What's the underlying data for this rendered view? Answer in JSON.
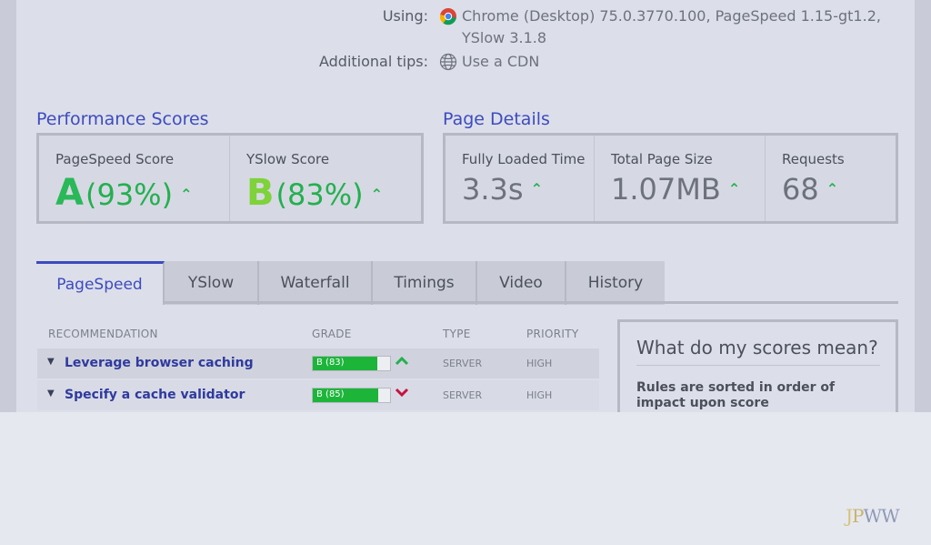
{
  "info": {
    "using_label": "Using:",
    "using_value_line1": "Chrome (Desktop) 75.0.3770.100, PageSpeed 1.15-gt1.2,",
    "using_value_line2": "YSlow 3.1.8",
    "tips_label": "Additional tips:",
    "tips_value": "Use a CDN",
    "icons": [
      "chrome-icon",
      "globe-icon"
    ]
  },
  "performance": {
    "title": "Performance Scores",
    "pagespeed": {
      "label": "PageSpeed Score",
      "grade": "A",
      "score": "(93%)"
    },
    "yslow": {
      "label": "YSlow Score",
      "grade": "B",
      "score": "(83%)"
    }
  },
  "details": {
    "title": "Page Details",
    "loaded": {
      "label": "Fully Loaded Time",
      "value": "3.3s"
    },
    "size": {
      "label": "Total Page Size",
      "value": "1.07MB"
    },
    "requests": {
      "label": "Requests",
      "value": "68"
    }
  },
  "tabs": [
    "PageSpeed",
    "YSlow",
    "Waterfall",
    "Timings",
    "Video",
    "History"
  ],
  "table": {
    "headers": {
      "recommendation": "RECOMMENDATION",
      "grade": "GRADE",
      "type": "TYPE",
      "priority": "PRIORITY"
    },
    "rows": [
      {
        "recommendation": "Leverage browser caching",
        "grade_text": "B (83)",
        "grade_value": 83,
        "trend": "up",
        "type": "SERVER",
        "priority": "HIGH"
      },
      {
        "recommendation": "Specify a cache validator",
        "grade_text": "B (85)",
        "grade_value": 85,
        "trend": "down",
        "type": "SERVER",
        "priority": "HIGH"
      }
    ]
  },
  "side": {
    "title": "What do my scores mean?",
    "text": "Rules are sorted in order of impact upon score"
  },
  "colors": {
    "accent": "#3d4bbf",
    "good": "#23b04f",
    "bad": "#c8123c",
    "bar": "#1cb53a"
  },
  "logo": {
    "text": "JPWW"
  }
}
